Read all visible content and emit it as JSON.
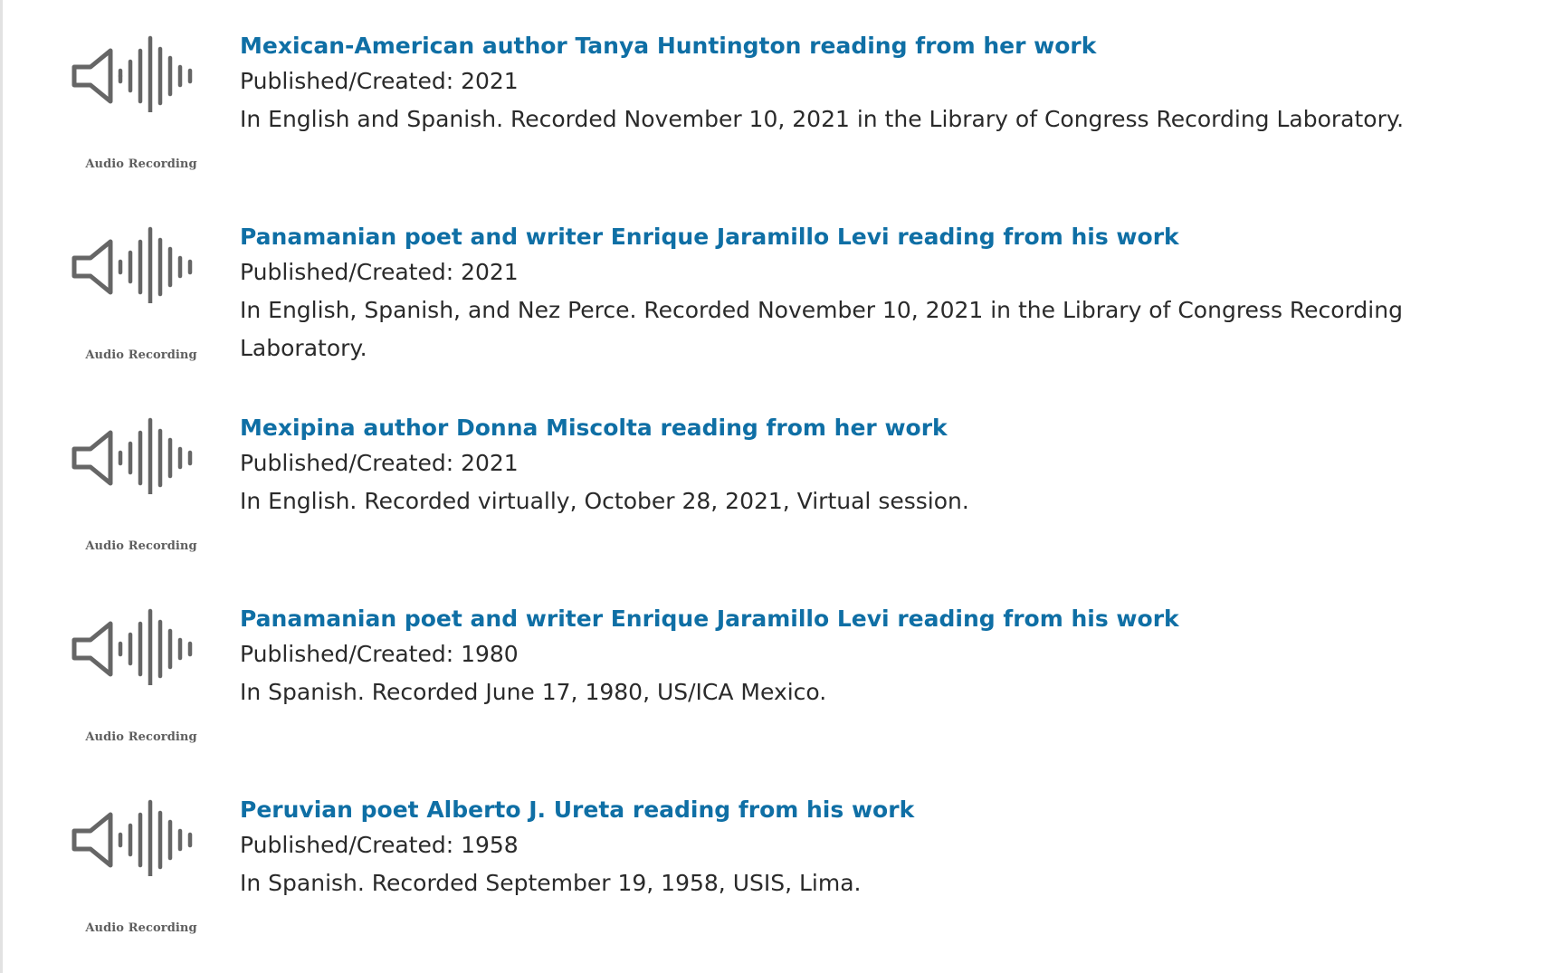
{
  "results": [
    {
      "title": "Mexican-American author Tanya Huntington reading from her work",
      "published": "Published/Created: 2021",
      "description": "In English and Spanish. Recorded November 10, 2021 in the Library of Congress Recording Laboratory.",
      "format_label": "Audio Recording",
      "icon": "audio-recording-icon"
    },
    {
      "title": "Panamanian poet and writer Enrique Jaramillo Levi reading from his work",
      "published": "Published/Created: 2021",
      "description": "In English, Spanish, and Nez Perce. Recorded November 10, 2021 in the Library of Congress Recording Laboratory.",
      "format_label": "Audio Recording",
      "icon": "audio-recording-icon"
    },
    {
      "title": "Mexipina author Donna Miscolta reading from her work",
      "published": "Published/Created: 2021",
      "description": "In English. Recorded virtually, October 28, 2021, Virtual session.",
      "format_label": "Audio Recording",
      "icon": "audio-recording-icon"
    },
    {
      "title": "Panamanian poet and writer Enrique Jaramillo Levi reading from his work",
      "published": "Published/Created: 1980",
      "description": "In Spanish. Recorded June 17, 1980, US/ICA Mexico.",
      "format_label": "Audio Recording",
      "icon": "audio-recording-icon"
    },
    {
      "title": "Peruvian poet Alberto J. Ureta reading from his work",
      "published": "Published/Created: 1958",
      "description": "In Spanish. Recorded September 19, 1958, USIS, Lima.",
      "format_label": "Audio Recording",
      "icon": "audio-recording-icon"
    }
  ],
  "colors": {
    "link": "#0f6fa5",
    "text": "#2a2a2a",
    "icon": "#666666"
  }
}
